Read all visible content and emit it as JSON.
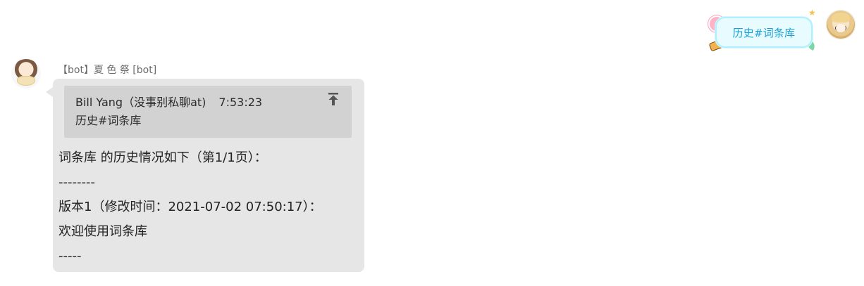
{
  "user_message": {
    "text": "历史#词条库"
  },
  "bot_message": {
    "sender": "【bot】夏 色 祭 [bot]",
    "quote": {
      "author": "Bill Yang（没事别私聊at)",
      "time": "7:53:23",
      "text": "历史#词条库"
    },
    "lines": [
      "词条库 的历史情况如下（第1/1页）：",
      "--------",
      "版本1（修改时间：2021-07-02 07:50:17）：",
      "欢迎使用词条库",
      "-----"
    ]
  },
  "colors": {
    "user_bubble_bg": "#e8fbff",
    "user_bubble_text": "#1aa0d8",
    "bot_bubble_bg": "#e6e6e6",
    "quote_bg": "#d2d2d2",
    "sender_text": "#6b6b6b"
  },
  "icons": {
    "user_avatar": "anime-avatar-icon",
    "bot_avatar": "anime-avatar-icon",
    "quote_jump": "arrow-to-top-icon"
  }
}
